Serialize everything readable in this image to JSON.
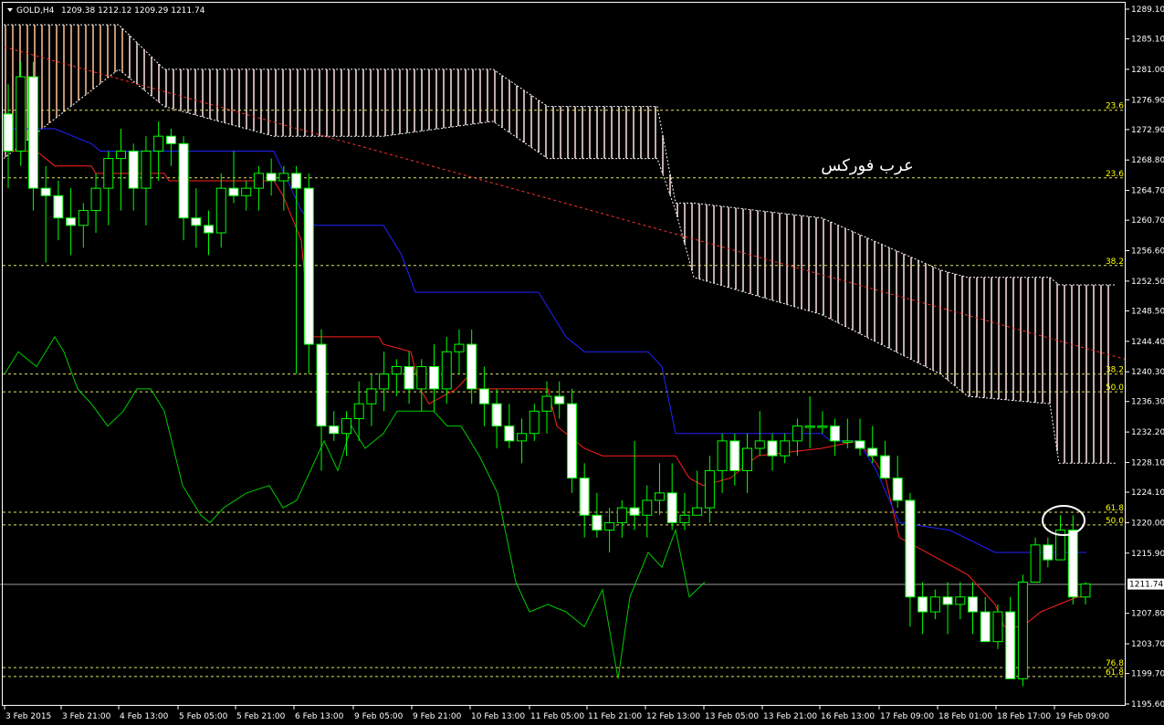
{
  "header": {
    "symbol_label": "GOLD,H4",
    "ohlc": "1209.38 1212.12 1209.29 1211.74"
  },
  "watermark": "عرب فوركس",
  "chart_data": {
    "type": "candlestick",
    "title": "GOLD,H4",
    "ylim": [
      1195.6,
      1289.1
    ],
    "y_ticks": [
      "1289.10",
      "1285.10",
      "1281.00",
      "1276.90",
      "1272.90",
      "1268.80",
      "1264.70",
      "1260.70",
      "1256.60",
      "1252.50",
      "1248.50",
      "1244.40",
      "1240.30",
      "1236.30",
      "1232.20",
      "1228.10",
      "1224.10",
      "1220.00",
      "1215.90",
      "1211.74",
      "1207.80",
      "1203.70",
      "1199.70",
      "1195.60"
    ],
    "x_ticks": [
      "3 Feb 2015",
      "3 Feb 21:00",
      "4 Feb 13:00",
      "5 Feb 05:00",
      "5 Feb 21:00",
      "6 Feb 13:00",
      "9 Feb 05:00",
      "9 Feb 21:00",
      "10 Feb 13:00",
      "11 Feb 05:00",
      "11 Feb 21:00",
      "12 Feb 13:00",
      "13 Feb 05:00",
      "13 Feb 21:00",
      "16 Feb 13:00",
      "17 Feb 09:00",
      "18 Feb 01:00",
      "18 Feb 17:00",
      "19 Feb 09:00"
    ],
    "current_price": "1211.74",
    "fib_levels": [
      {
        "label": "23.6",
        "price": 1275.5
      },
      {
        "label": "23.6",
        "price": 1266.4
      },
      {
        "label": "38.2",
        "price": 1254.6
      },
      {
        "label": "38.2",
        "price": 1240.0
      },
      {
        "label": "50.0",
        "price": 1237.6
      },
      {
        "label": "61.8",
        "price": 1221.4
      },
      {
        "label": "50.0",
        "price": 1219.7
      },
      {
        "label": "76.8",
        "price": 1200.5
      },
      {
        "label": "61.8",
        "price": 1199.3
      }
    ],
    "candles": [
      [
        1275,
        1279,
        1265,
        1270
      ],
      [
        1270,
        1282,
        1268,
        1280
      ],
      [
        1280,
        1282,
        1262,
        1265
      ],
      [
        1265,
        1268,
        1255,
        1264
      ],
      [
        1264,
        1266,
        1258,
        1261
      ],
      [
        1261,
        1265,
        1256,
        1260
      ],
      [
        1260,
        1263,
        1257,
        1262
      ],
      [
        1262,
        1267,
        1259,
        1265
      ],
      [
        1265,
        1270,
        1260,
        1269
      ],
      [
        1269,
        1273,
        1262,
        1270
      ],
      [
        1270,
        1271,
        1262,
        1265
      ],
      [
        1265,
        1272,
        1260,
        1270
      ],
      [
        1270,
        1274,
        1266,
        1272
      ],
      [
        1272,
        1273,
        1268,
        1271
      ],
      [
        1271,
        1272,
        1258,
        1261
      ],
      [
        1261,
        1265,
        1257,
        1260
      ],
      [
        1260,
        1262,
        1256,
        1259
      ],
      [
        1259,
        1267,
        1257,
        1265
      ],
      [
        1265,
        1270,
        1263,
        1264
      ],
      [
        1264,
        1266,
        1262,
        1265
      ],
      [
        1265,
        1268,
        1262,
        1267
      ],
      [
        1267,
        1269,
        1264,
        1266
      ],
      [
        1266,
        1268,
        1262,
        1267
      ],
      [
        1267,
        1268,
        1240,
        1265
      ],
      [
        1265,
        1267,
        1240,
        1244
      ],
      [
        1244,
        1246,
        1227,
        1233
      ],
      [
        1233,
        1235,
        1231,
        1232
      ],
      [
        1232,
        1235,
        1229,
        1234
      ],
      [
        1234,
        1239,
        1231,
        1236
      ],
      [
        1236,
        1240,
        1233,
        1238
      ],
      [
        1238,
        1243,
        1235,
        1240
      ],
      [
        1240,
        1242,
        1237,
        1241
      ],
      [
        1241,
        1243,
        1236,
        1238
      ],
      [
        1238,
        1242,
        1235,
        1241
      ],
      [
        1241,
        1244,
        1235,
        1238
      ],
      [
        1238,
        1245,
        1236,
        1243
      ],
      [
        1243,
        1246,
        1240,
        1244
      ],
      [
        1244,
        1246,
        1236,
        1238
      ],
      [
        1238,
        1241,
        1233,
        1236
      ],
      [
        1236,
        1238,
        1230,
        1233
      ],
      [
        1233,
        1236,
        1230,
        1231
      ],
      [
        1231,
        1234,
        1228,
        1232
      ],
      [
        1232,
        1236,
        1231,
        1235
      ],
      [
        1235,
        1239,
        1232,
        1237
      ],
      [
        1237,
        1239,
        1234,
        1236
      ],
      [
        1236,
        1238,
        1224,
        1226
      ],
      [
        1226,
        1228,
        1218,
        1221
      ],
      [
        1221,
        1224,
        1218,
        1219
      ],
      [
        1219,
        1222,
        1216,
        1220
      ],
      [
        1220,
        1223,
        1218,
        1222
      ],
      [
        1222,
        1231,
        1219,
        1221
      ],
      [
        1221,
        1225,
        1218,
        1223
      ],
      [
        1223,
        1228,
        1221,
        1224
      ],
      [
        1224,
        1228,
        1219,
        1220
      ],
      [
        1220,
        1224,
        1219,
        1221
      ],
      [
        1221,
        1227,
        1221,
        1222
      ],
      [
        1222,
        1229,
        1220,
        1227
      ],
      [
        1227,
        1232,
        1224,
        1231
      ],
      [
        1231,
        1232,
        1225,
        1227
      ],
      [
        1227,
        1232,
        1224,
        1230
      ],
      [
        1230,
        1235,
        1229,
        1231
      ],
      [
        1231,
        1232,
        1227,
        1229
      ],
      [
        1229,
        1232,
        1228,
        1231
      ],
      [
        1231,
        1234,
        1229,
        1233
      ],
      [
        1233,
        1237,
        1230,
        1233
      ],
      [
        1233,
        1235,
        1232,
        1233
      ],
      [
        1233,
        1234,
        1229,
        1231
      ],
      [
        1231,
        1234,
        1230,
        1231
      ],
      [
        1231,
        1234,
        1229,
        1230
      ],
      [
        1230,
        1233,
        1228,
        1229
      ],
      [
        1229,
        1231,
        1226,
        1226
      ],
      [
        1226,
        1229,
        1222,
        1223
      ],
      [
        1223,
        1224,
        1206,
        1210
      ],
      [
        1210,
        1212,
        1205,
        1208
      ],
      [
        1208,
        1211,
        1207,
        1210
      ],
      [
        1210,
        1212,
        1205,
        1209
      ],
      [
        1209,
        1212,
        1207,
        1210
      ],
      [
        1210,
        1212,
        1205,
        1208
      ],
      [
        1208,
        1210,
        1204,
        1204
      ],
      [
        1204,
        1209,
        1203,
        1208
      ],
      [
        1208,
        1210,
        1199,
        1199
      ],
      [
        1199,
        1213,
        1198,
        1212
      ],
      [
        1212,
        1218,
        1212,
        1217
      ],
      [
        1217,
        1218,
        1214,
        1215
      ],
      [
        1215,
        1221,
        1215,
        1219
      ],
      [
        1219,
        1221,
        1209,
        1210
      ],
      [
        1210,
        1212,
        1209,
        1211.74
      ]
    ]
  }
}
